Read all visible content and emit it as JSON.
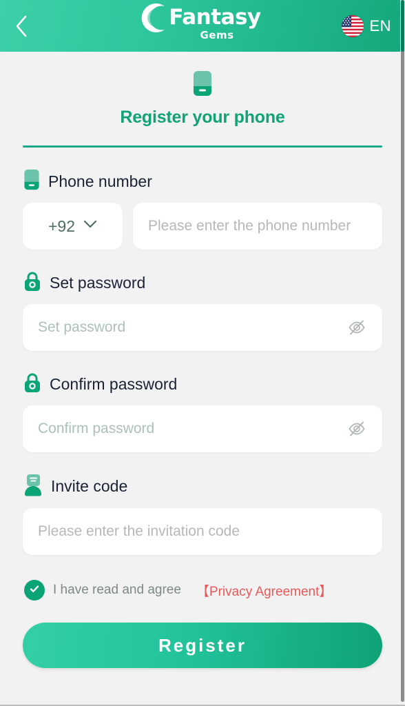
{
  "header": {
    "back_icon": "chevron-left-icon",
    "logo_main": "Fantasy",
    "logo_sub": "Gems",
    "logo_mark": "crescent-c-icon",
    "flag_icon": "us-flag-icon",
    "language": "EN"
  },
  "title": {
    "icon": "phone-device-icon",
    "text": "Register your phone"
  },
  "form": {
    "phone": {
      "label": "Phone number",
      "label_icon": "phone-device-icon",
      "country_code": "+92",
      "country_chevron": "chevron-down-icon",
      "placeholder": "Please enter the phone number",
      "value": ""
    },
    "password": {
      "label": "Set password",
      "label_icon": "lock-icon",
      "placeholder": "Set password",
      "value": "",
      "toggle_icon": "eye-off-icon"
    },
    "confirm_password": {
      "label": "Confirm password",
      "label_icon": "lock-icon",
      "placeholder": "Confirm password",
      "value": "",
      "toggle_icon": "eye-off-icon"
    },
    "invite": {
      "label": "Invite code",
      "label_icon": "invite-card-icon",
      "placeholder": "Please enter the invitation code",
      "value": ""
    }
  },
  "agreement": {
    "checkbox_icon": "check-circle-icon",
    "checked": true,
    "text": "I have read and agree",
    "link": "【Privacy Agreement】"
  },
  "actions": {
    "register_label": "Register"
  },
  "colors": {
    "brand_green": "#11a376",
    "header_gradient_start": "#3ccfa9",
    "header_gradient_end": "#14a87c",
    "accent_red": "#e8595a",
    "page_bg": "#f1f2f1",
    "label_text": "#1a2236",
    "placeholder": "#b4b9b7"
  }
}
